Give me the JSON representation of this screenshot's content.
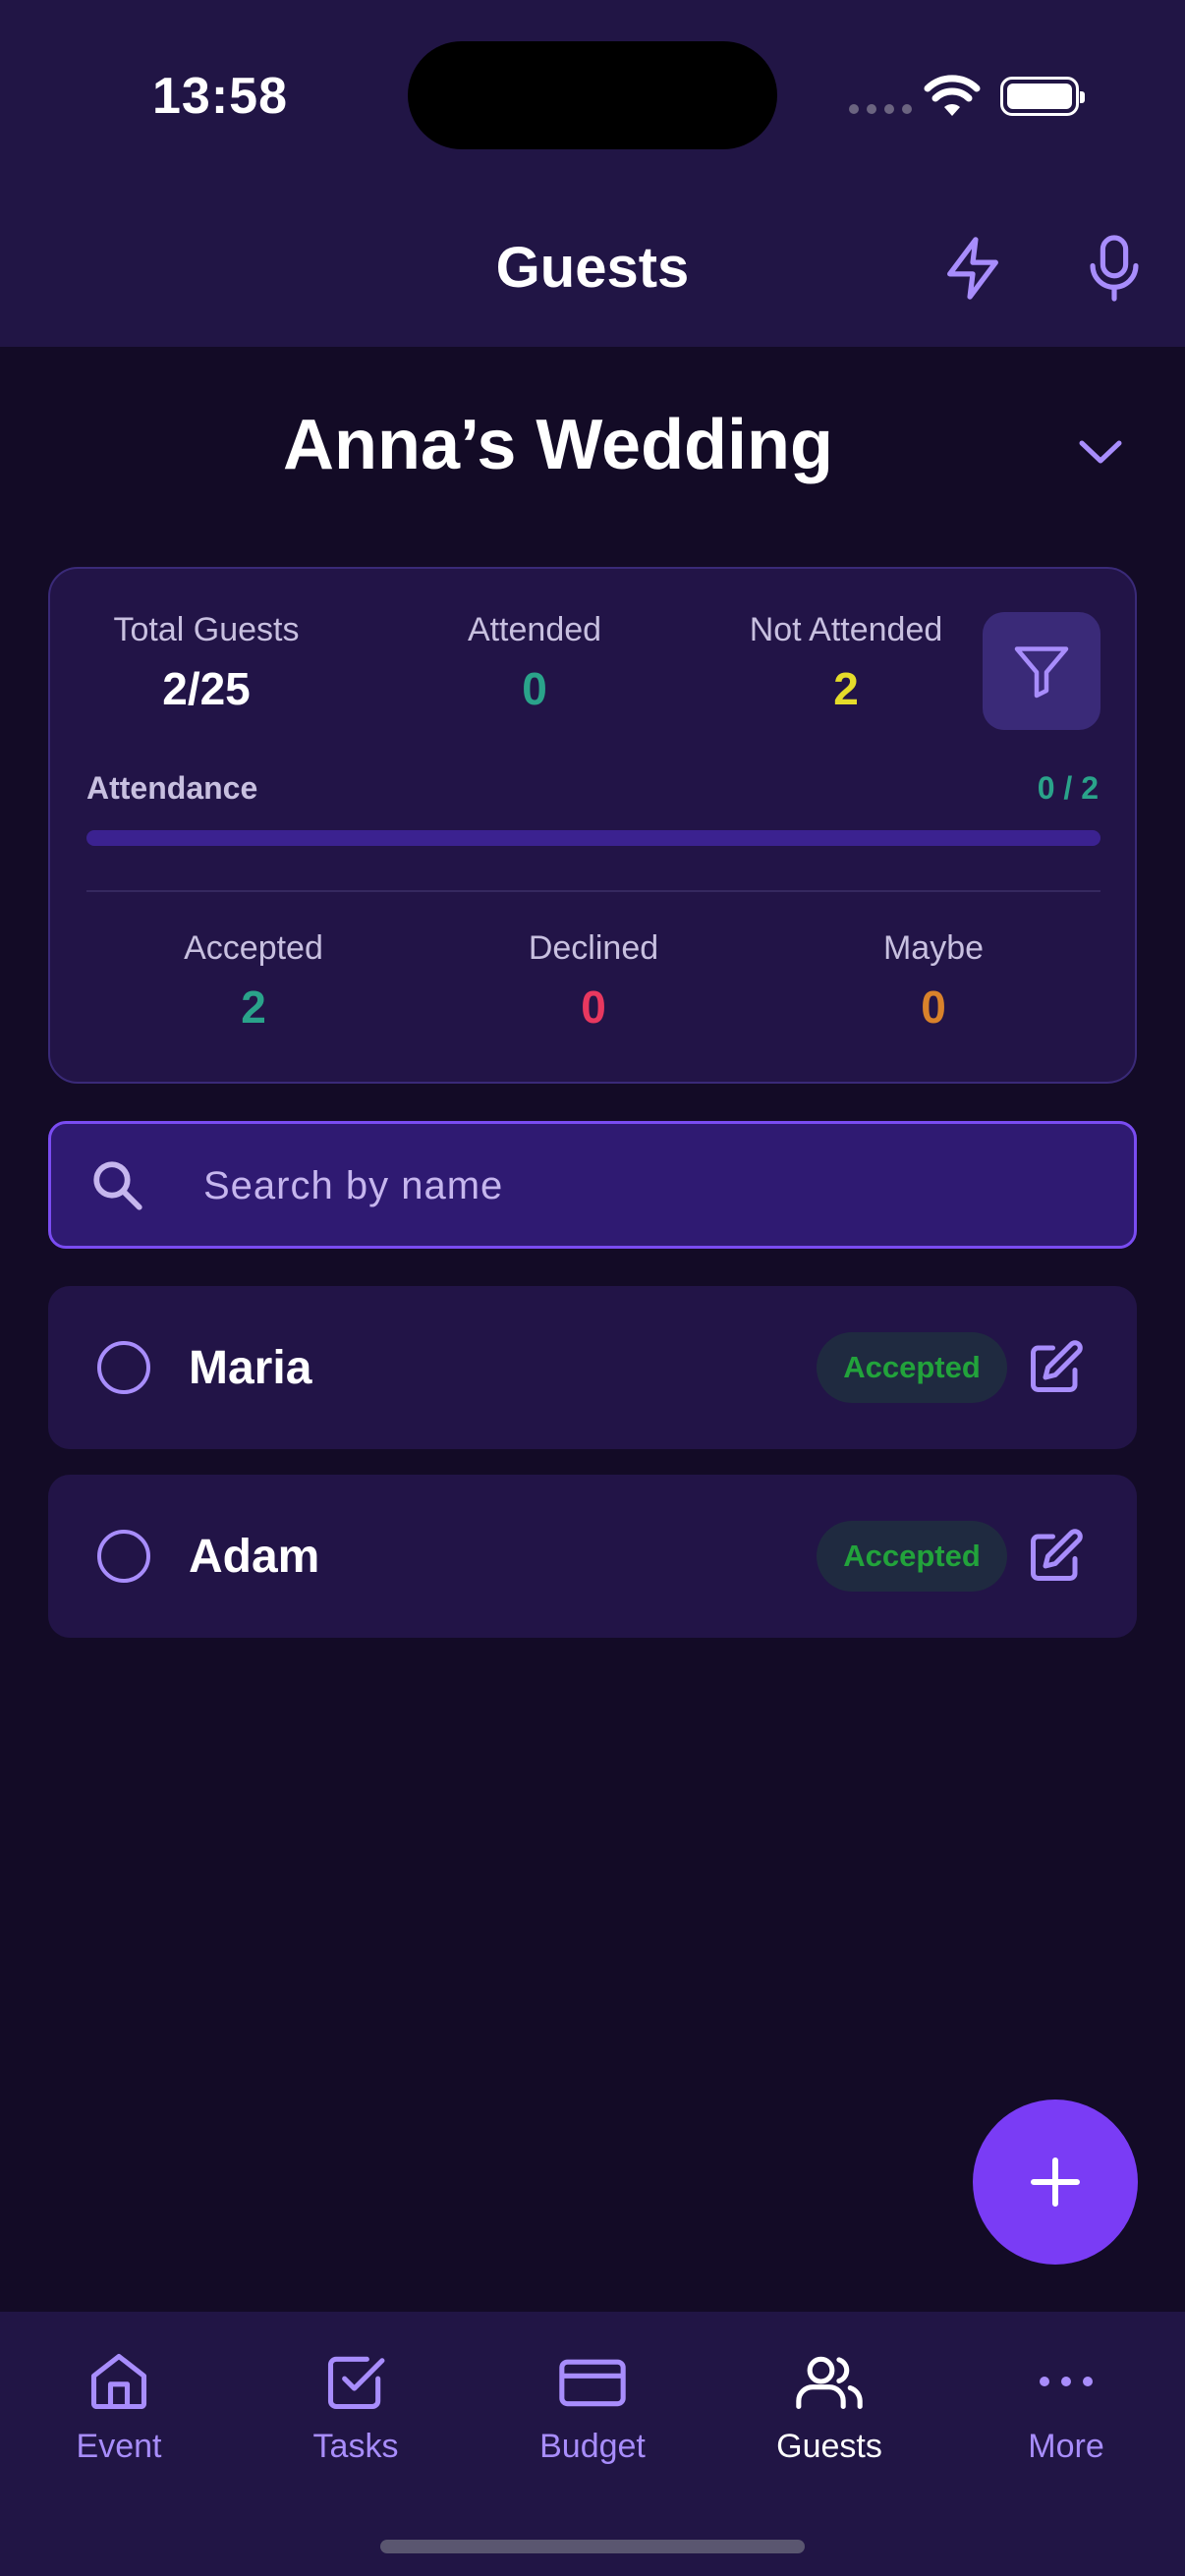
{
  "status_bar": {
    "time": "13:58"
  },
  "header": {
    "title": "Guests",
    "bolt_icon": "lightning-bolt-icon",
    "mic_icon": "microphone-icon"
  },
  "event": {
    "name": "Anna’s Wedding"
  },
  "stats": {
    "total_label": "Total Guests",
    "total_value": "2/25",
    "attended_label": "Attended",
    "attended_value": "0",
    "not_attended_label": "Not Attended",
    "not_attended_value": "2",
    "attendance_label": "Attendance",
    "attendance_count": "0 / 2",
    "attendance_fraction": 0,
    "accepted_label": "Accepted",
    "accepted_value": "2",
    "declined_label": "Declined",
    "declined_value": "0",
    "maybe_label": "Maybe",
    "maybe_value": "0"
  },
  "colors": {
    "accent": "#7a3cf5",
    "teal": "#2aa38a",
    "yellow": "#e5dc2a",
    "red": "#e8385f",
    "orange": "#d9822b",
    "accepted_badge": "#22a33b"
  },
  "search": {
    "placeholder": "Search by name",
    "value": ""
  },
  "guests": [
    {
      "name": "Maria",
      "status": "Accepted"
    },
    {
      "name": "Adam",
      "status": "Accepted"
    }
  ],
  "nav": [
    {
      "label": "Event",
      "icon": "home-icon"
    },
    {
      "label": "Tasks",
      "icon": "checkbox-icon"
    },
    {
      "label": "Budget",
      "icon": "credit-card-icon"
    },
    {
      "label": "Guests",
      "icon": "users-icon",
      "active": true
    },
    {
      "label": "More",
      "icon": "more-dots-icon"
    }
  ]
}
